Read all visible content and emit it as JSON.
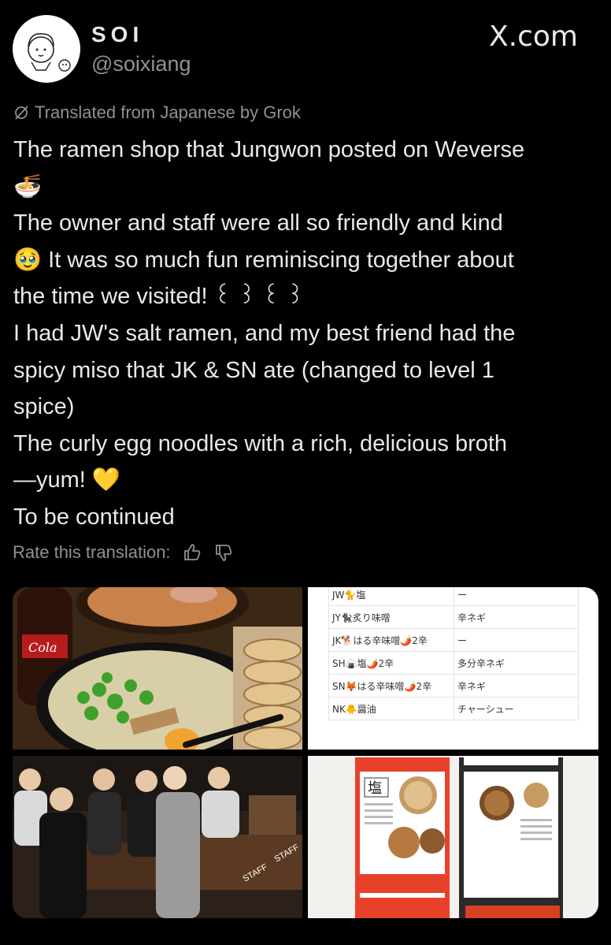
{
  "header": {
    "display_name": "SOI",
    "handle": "@soixiang",
    "source_logo": "X.com",
    "avatar_icon": "cartoon-face-avatar"
  },
  "translation_notice": {
    "icon": "grok-icon",
    "text": "Translated from Japanese by Grok"
  },
  "post": {
    "lines": [
      "The ramen shop that Jungwon posted on Weverse",
      "🍜",
      "The owner and staff were all so friendly and kind",
      "🥹 It was so much fun reminiscing together about",
      "the time we visited! ꒰ ꒱ ꒰ ꒱",
      "I had JW's salt ramen, and my best friend had the",
      "spicy miso that JK & SN ate (changed to level 1",
      "spice)",
      "The curly egg noodles with a rich, delicious broth",
      "—yum! 💛",
      "To be continued"
    ]
  },
  "rating": {
    "label": "Rate this translation:",
    "up_icon": "thumbs-up-icon",
    "down_icon": "thumbs-down-icon"
  },
  "media": {
    "photo1": "ramen-and-gyoza-photo",
    "photo3": "group-photo-in-restaurant",
    "photo3_text": "STAFF",
    "photo4": "menu-photo",
    "table": [
      {
        "name": "JW🐈塩",
        "topping": "ー"
      },
      {
        "name": "JY🐈‍⬛炙り味噌",
        "topping": "辛ネギ"
      },
      {
        "name": "JK🐕はる辛味噌🌶️2辛",
        "topping": "ー"
      },
      {
        "name": "SH🍙塩🌶️2辛",
        "topping": "多分辛ネギ"
      },
      {
        "name": "SN🦊はる辛味噌🌶️2辛",
        "topping": "辛ネギ"
      },
      {
        "name": "NK🐥醤油",
        "topping": "チャーシュー"
      }
    ]
  }
}
